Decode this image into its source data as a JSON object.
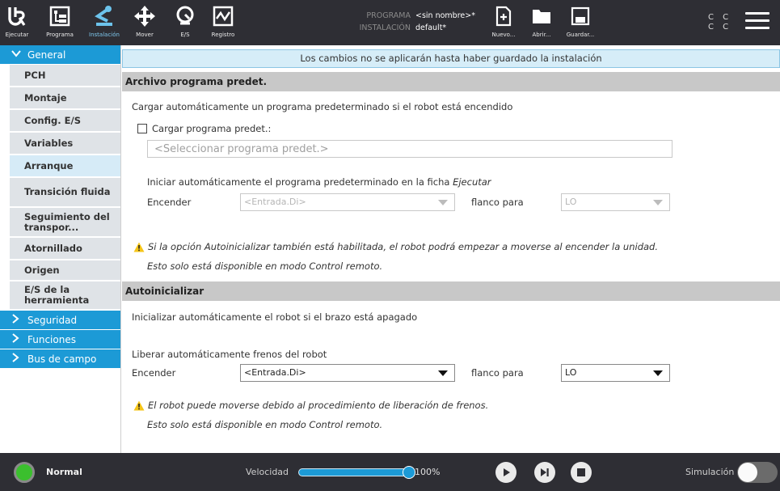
{
  "topbar": {
    "ejecutar": "Ejecutar",
    "programa": "Programa",
    "instalacion": "Instalación",
    "mover": "Mover",
    "es": "E/S",
    "registro": "Registro",
    "programa_key": "PROGRAMA",
    "programa_val": "<sin nombre>*",
    "instalacion_key": "INSTALACIÓN",
    "instalacion_val": "default*",
    "nuevo": "Nuevo...",
    "abrir": "Abrir...",
    "guardar": "Guardar...",
    "cc1": "C C",
    "cc2": "C C"
  },
  "sidebar": {
    "general": "General",
    "items": [
      "PCH",
      "Montaje",
      "Config. E/S",
      "Variables",
      "Arranque",
      "Transición fluida",
      "Seguimiento del transpor...",
      "Atornillado",
      "Origen",
      "E/S de la herramienta"
    ],
    "seguridad": "Seguridad",
    "funciones": "Funciones",
    "bus": "Bus de campo"
  },
  "main": {
    "banner": "Los cambios no se aplicarán hasta haber guardado la instalación",
    "sec1_title": "Archivo programa predet.",
    "sec1_desc": "Cargar automáticamente un programa predeterminado si el robot está encendido",
    "load_checkbox_label": "Cargar programa predet.:",
    "select_program_placeholder": "<Seleccionar programa predet.>",
    "autostart_text_pre": "Iniciar automáticamente el programa predeterminado en la ficha ",
    "autostart_text_em": "Ejecutar",
    "encender1_label": "Encender",
    "encender1_value": "<Entrada.Di>",
    "flanco1_label": "flanco para",
    "flanco1_value": "LO",
    "warn1_line1": "Si la opción Autoinicializar también está habilitada, el robot podrá empezar a moverse al encender la unidad.",
    "warn1_line2": "Esto solo está disponible en modo Control remoto.",
    "sec2_title": "Autoinicializar",
    "sec2_desc": "Inicializar automáticamente el robot si el brazo está apagado",
    "brakes_label": "Liberar automáticamente frenos del robot",
    "encender2_label": "Encender",
    "encender2_value": "<Entrada.Di>",
    "flanco2_label": "flanco para",
    "flanco2_value": "LO",
    "warn2_line1": "El robot puede moverse debido al procedimiento de liberación de frenos.",
    "warn2_line2": "Esto solo está disponible en modo Control remoto."
  },
  "bottombar": {
    "status": "Normal",
    "speed_label": "Velocidad",
    "speed_value": "100%",
    "speed_fraction": 1.0,
    "sim_label": "Simulación",
    "sim_on": false
  },
  "colors": {
    "accent": "#1c9ad6",
    "topbar_bg": "#2e2e34",
    "status_ok": "#3bbf2e",
    "warning": "#f5c518"
  }
}
